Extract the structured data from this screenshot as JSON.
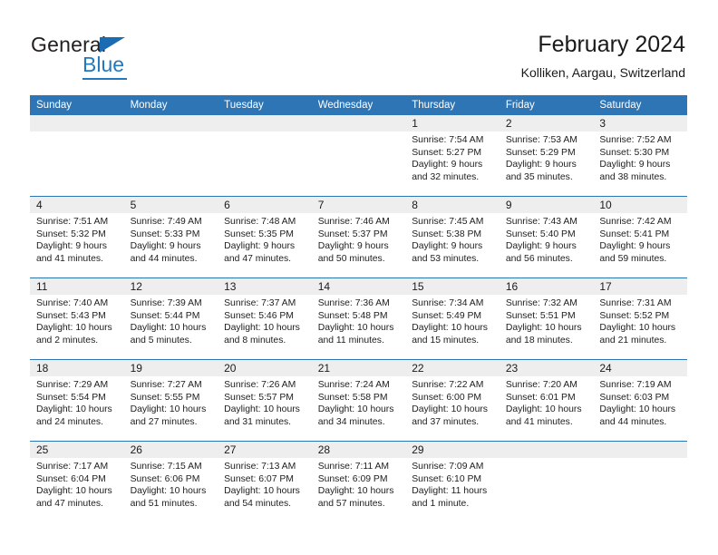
{
  "branding": {
    "logo_primary": "General",
    "logo_secondary": "Blue",
    "logo_triangle_icon": "triangle-icon",
    "brand_color": "#2479bd"
  },
  "header": {
    "title": "February 2024",
    "subtitle": "Kolliken, Aargau, Switzerland"
  },
  "theme": {
    "header_bar_color": "#2e75b6",
    "date_band_color": "#eeeeee",
    "text_color": "#1d1d1d"
  },
  "weekdays": [
    "Sunday",
    "Monday",
    "Tuesday",
    "Wednesday",
    "Thursday",
    "Friday",
    "Saturday"
  ],
  "weeks": [
    [
      {
        "day": "",
        "blank": true
      },
      {
        "day": "",
        "blank": true
      },
      {
        "day": "",
        "blank": true
      },
      {
        "day": "",
        "blank": true
      },
      {
        "day": "1",
        "sunrise": "Sunrise: 7:54 AM",
        "sunset": "Sunset: 5:27 PM",
        "daylight_line1": "Daylight: 9 hours",
        "daylight_line2": "and 32 minutes."
      },
      {
        "day": "2",
        "sunrise": "Sunrise: 7:53 AM",
        "sunset": "Sunset: 5:29 PM",
        "daylight_line1": "Daylight: 9 hours",
        "daylight_line2": "and 35 minutes."
      },
      {
        "day": "3",
        "sunrise": "Sunrise: 7:52 AM",
        "sunset": "Sunset: 5:30 PM",
        "daylight_line1": "Daylight: 9 hours",
        "daylight_line2": "and 38 minutes."
      }
    ],
    [
      {
        "day": "4",
        "sunrise": "Sunrise: 7:51 AM",
        "sunset": "Sunset: 5:32 PM",
        "daylight_line1": "Daylight: 9 hours",
        "daylight_line2": "and 41 minutes."
      },
      {
        "day": "5",
        "sunrise": "Sunrise: 7:49 AM",
        "sunset": "Sunset: 5:33 PM",
        "daylight_line1": "Daylight: 9 hours",
        "daylight_line2": "and 44 minutes."
      },
      {
        "day": "6",
        "sunrise": "Sunrise: 7:48 AM",
        "sunset": "Sunset: 5:35 PM",
        "daylight_line1": "Daylight: 9 hours",
        "daylight_line2": "and 47 minutes."
      },
      {
        "day": "7",
        "sunrise": "Sunrise: 7:46 AM",
        "sunset": "Sunset: 5:37 PM",
        "daylight_line1": "Daylight: 9 hours",
        "daylight_line2": "and 50 minutes."
      },
      {
        "day": "8",
        "sunrise": "Sunrise: 7:45 AM",
        "sunset": "Sunset: 5:38 PM",
        "daylight_line1": "Daylight: 9 hours",
        "daylight_line2": "and 53 minutes."
      },
      {
        "day": "9",
        "sunrise": "Sunrise: 7:43 AM",
        "sunset": "Sunset: 5:40 PM",
        "daylight_line1": "Daylight: 9 hours",
        "daylight_line2": "and 56 minutes."
      },
      {
        "day": "10",
        "sunrise": "Sunrise: 7:42 AM",
        "sunset": "Sunset: 5:41 PM",
        "daylight_line1": "Daylight: 9 hours",
        "daylight_line2": "and 59 minutes."
      }
    ],
    [
      {
        "day": "11",
        "sunrise": "Sunrise: 7:40 AM",
        "sunset": "Sunset: 5:43 PM",
        "daylight_line1": "Daylight: 10 hours",
        "daylight_line2": "and 2 minutes."
      },
      {
        "day": "12",
        "sunrise": "Sunrise: 7:39 AM",
        "sunset": "Sunset: 5:44 PM",
        "daylight_line1": "Daylight: 10 hours",
        "daylight_line2": "and 5 minutes."
      },
      {
        "day": "13",
        "sunrise": "Sunrise: 7:37 AM",
        "sunset": "Sunset: 5:46 PM",
        "daylight_line1": "Daylight: 10 hours",
        "daylight_line2": "and 8 minutes."
      },
      {
        "day": "14",
        "sunrise": "Sunrise: 7:36 AM",
        "sunset": "Sunset: 5:48 PM",
        "daylight_line1": "Daylight: 10 hours",
        "daylight_line2": "and 11 minutes."
      },
      {
        "day": "15",
        "sunrise": "Sunrise: 7:34 AM",
        "sunset": "Sunset: 5:49 PM",
        "daylight_line1": "Daylight: 10 hours",
        "daylight_line2": "and 15 minutes."
      },
      {
        "day": "16",
        "sunrise": "Sunrise: 7:32 AM",
        "sunset": "Sunset: 5:51 PM",
        "daylight_line1": "Daylight: 10 hours",
        "daylight_line2": "and 18 minutes."
      },
      {
        "day": "17",
        "sunrise": "Sunrise: 7:31 AM",
        "sunset": "Sunset: 5:52 PM",
        "daylight_line1": "Daylight: 10 hours",
        "daylight_line2": "and 21 minutes."
      }
    ],
    [
      {
        "day": "18",
        "sunrise": "Sunrise: 7:29 AM",
        "sunset": "Sunset: 5:54 PM",
        "daylight_line1": "Daylight: 10 hours",
        "daylight_line2": "and 24 minutes."
      },
      {
        "day": "19",
        "sunrise": "Sunrise: 7:27 AM",
        "sunset": "Sunset: 5:55 PM",
        "daylight_line1": "Daylight: 10 hours",
        "daylight_line2": "and 27 minutes."
      },
      {
        "day": "20",
        "sunrise": "Sunrise: 7:26 AM",
        "sunset": "Sunset: 5:57 PM",
        "daylight_line1": "Daylight: 10 hours",
        "daylight_line2": "and 31 minutes."
      },
      {
        "day": "21",
        "sunrise": "Sunrise: 7:24 AM",
        "sunset": "Sunset: 5:58 PM",
        "daylight_line1": "Daylight: 10 hours",
        "daylight_line2": "and 34 minutes."
      },
      {
        "day": "22",
        "sunrise": "Sunrise: 7:22 AM",
        "sunset": "Sunset: 6:00 PM",
        "daylight_line1": "Daylight: 10 hours",
        "daylight_line2": "and 37 minutes."
      },
      {
        "day": "23",
        "sunrise": "Sunrise: 7:20 AM",
        "sunset": "Sunset: 6:01 PM",
        "daylight_line1": "Daylight: 10 hours",
        "daylight_line2": "and 41 minutes."
      },
      {
        "day": "24",
        "sunrise": "Sunrise: 7:19 AM",
        "sunset": "Sunset: 6:03 PM",
        "daylight_line1": "Daylight: 10 hours",
        "daylight_line2": "and 44 minutes."
      }
    ],
    [
      {
        "day": "25",
        "sunrise": "Sunrise: 7:17 AM",
        "sunset": "Sunset: 6:04 PM",
        "daylight_line1": "Daylight: 10 hours",
        "daylight_line2": "and 47 minutes."
      },
      {
        "day": "26",
        "sunrise": "Sunrise: 7:15 AM",
        "sunset": "Sunset: 6:06 PM",
        "daylight_line1": "Daylight: 10 hours",
        "daylight_line2": "and 51 minutes."
      },
      {
        "day": "27",
        "sunrise": "Sunrise: 7:13 AM",
        "sunset": "Sunset: 6:07 PM",
        "daylight_line1": "Daylight: 10 hours",
        "daylight_line2": "and 54 minutes."
      },
      {
        "day": "28",
        "sunrise": "Sunrise: 7:11 AM",
        "sunset": "Sunset: 6:09 PM",
        "daylight_line1": "Daylight: 10 hours",
        "daylight_line2": "and 57 minutes."
      },
      {
        "day": "29",
        "sunrise": "Sunrise: 7:09 AM",
        "sunset": "Sunset: 6:10 PM",
        "daylight_line1": "Daylight: 11 hours",
        "daylight_line2": "and 1 minute."
      },
      {
        "day": "",
        "blank": true
      },
      {
        "day": "",
        "blank": true
      }
    ]
  ]
}
